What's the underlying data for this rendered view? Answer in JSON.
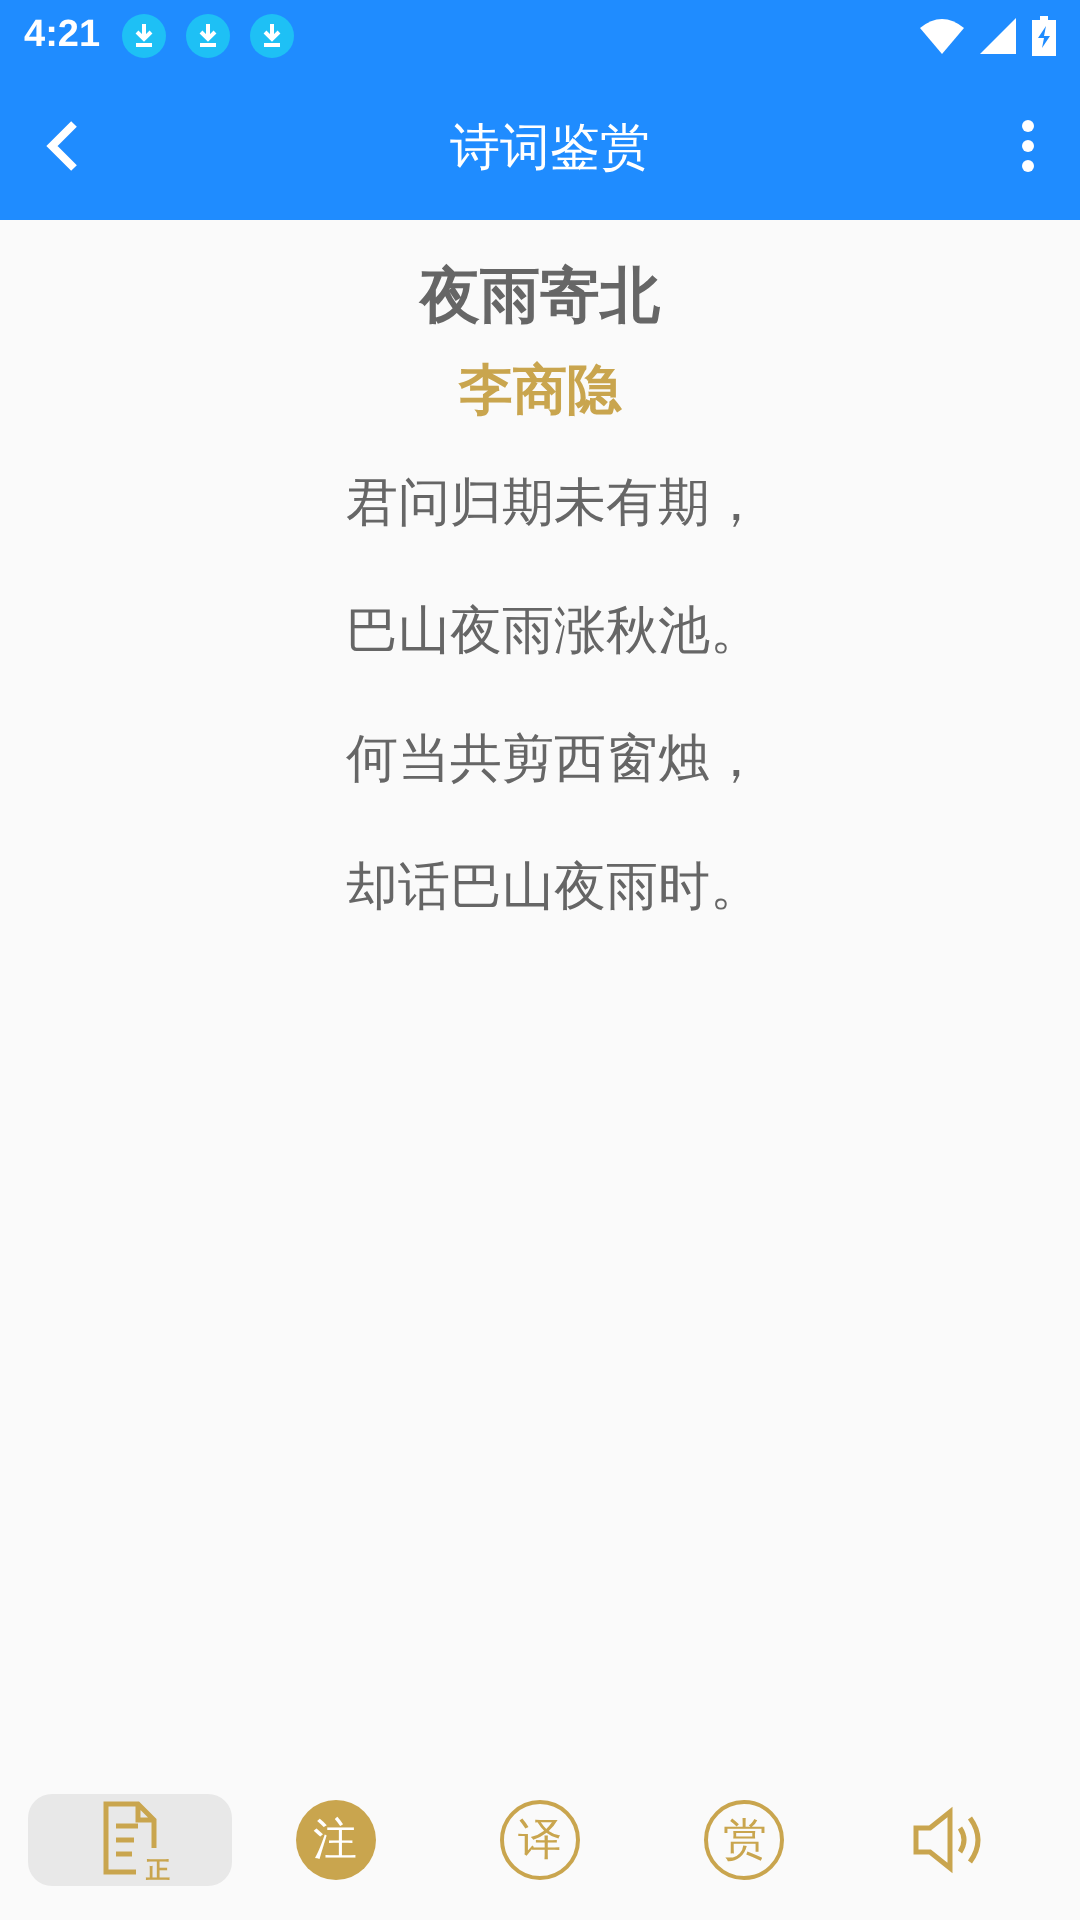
{
  "status_bar": {
    "time": "4:21",
    "notifications": [
      {
        "kind": "download"
      },
      {
        "kind": "download"
      },
      {
        "kind": "download"
      }
    ]
  },
  "app_bar": {
    "title": "诗词鉴赏"
  },
  "poem": {
    "title": "夜雨寄北",
    "author": "李商隐",
    "lines": [
      "君问归期未有期，",
      "巴山夜雨涨秋池。",
      "何当共剪西窗烛，",
      "却话巴山夜雨时。"
    ]
  },
  "bottom_bar": [
    {
      "kind": "doc",
      "label": "正",
      "selected": true
    },
    {
      "kind": "filled",
      "label": "注",
      "selected": false
    },
    {
      "kind": "ring",
      "label": "译",
      "selected": false
    },
    {
      "kind": "ring",
      "label": "赏",
      "selected": false
    },
    {
      "kind": "speaker",
      "selected": false
    }
  ]
}
